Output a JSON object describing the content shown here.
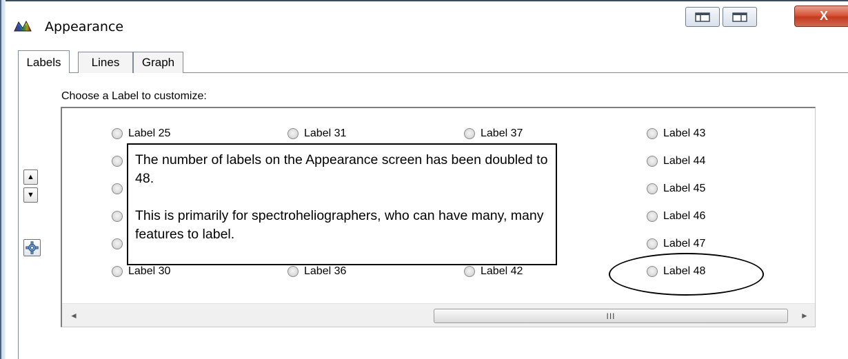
{
  "window": {
    "title": "Appearance",
    "close_label": "X"
  },
  "tabs": [
    {
      "label": "Labels",
      "active": true
    },
    {
      "label": "Lines",
      "active": false
    },
    {
      "label": "Graph",
      "active": false
    }
  ],
  "labels_panel": {
    "prompt": "Choose a Label to customize:",
    "options": [
      "Label 25",
      "Label 31",
      "Label 37",
      "Label 43",
      "Label 44",
      "Label 45",
      "Label 46",
      "Label 47",
      "Label 30",
      "Label 36",
      "Label 42",
      "Label 48"
    ]
  },
  "scrollbar": {
    "left_arrow": "◄",
    "right_arrow": "►",
    "grip": "III"
  },
  "callout": {
    "paragraph1": "The number of labels on the Appearance screen has been doubled to 48.",
    "paragraph2": "This is primarily for spectroheliographers, who can have many, many features to label."
  },
  "side_buttons": {
    "up": "▲",
    "down": "▼"
  }
}
